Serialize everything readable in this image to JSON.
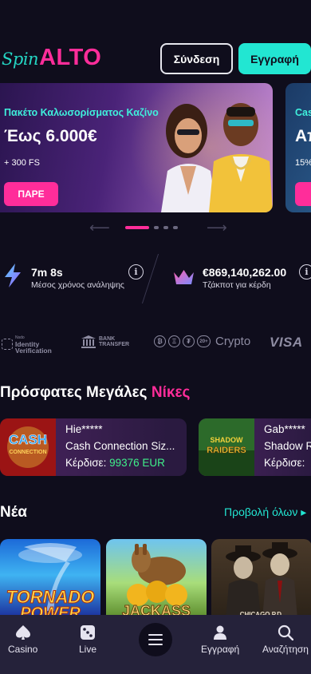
{
  "header": {
    "logo_spin": "Spin",
    "logo_alto": "ALTO",
    "login_label": "Σύνδεση",
    "register_label": "Εγγραφή"
  },
  "banner": {
    "kicker": "Πακέτο Καλωσορίσματος Καζίνο",
    "title": "Έως 6.000€",
    "subtitle": "+ 300 FS",
    "button": "ΠΑΡΕ",
    "next_kicker": "Cas",
    "next_title": "Απ",
    "next_subtitle": "15% α"
  },
  "carousel": {
    "dots": 4,
    "active": 0
  },
  "stats": {
    "withdrawal_time": "7m 8s",
    "withdrawal_label": "Μέσος χρόνος ανάληψης",
    "jackpot_value": "€869,140,262.00",
    "jackpot_label": "Τζάκποτ για κέρδη"
  },
  "payments": {
    "id_small": "Nsdo",
    "id_line1": "Identity",
    "id_line2": "Verification",
    "bank_line1": "BANK",
    "bank_line2": "TRANSFER",
    "coin_b": "₿",
    "coin_e": "Ξ",
    "coin_t": "₮",
    "coin_more": "20+",
    "crypto": "Crypto",
    "visa": "VISA"
  },
  "big_wins": {
    "title_main": "Πρόσφατες Μεγάλες",
    "title_highlight": "Νίκες",
    "won_label": "Κέρδισε:",
    "items": [
      {
        "user": "Hie*****",
        "game": "Cash Connection Siz...",
        "amount": "99376 EUR",
        "thumb_text1": "CASH",
        "thumb_text2": "CONNECTION"
      },
      {
        "user": "Gab*****",
        "game": "Shadow R",
        "amount": "",
        "thumb_text1": "SHADOW",
        "thumb_text2": "RAIDERS"
      }
    ]
  },
  "new_games": {
    "title": "Νέα",
    "view_all": "Προβολή όλων ▸",
    "tiles": [
      {
        "line1": "TORNADO",
        "line2": "POWER"
      },
      {
        "line1": "JACKASS",
        "line2": ""
      },
      {
        "line1": "CHICAGO P.D.",
        "line2": ""
      }
    ]
  },
  "bottom_nav": {
    "casino": "Casino",
    "live": "Live",
    "register": "Εγγραφή",
    "search": "Αναζήτηση"
  },
  "colors": {
    "accent_pink": "#ff2d9a",
    "accent_teal": "#22e6d2",
    "background": "#0f0d1c"
  }
}
